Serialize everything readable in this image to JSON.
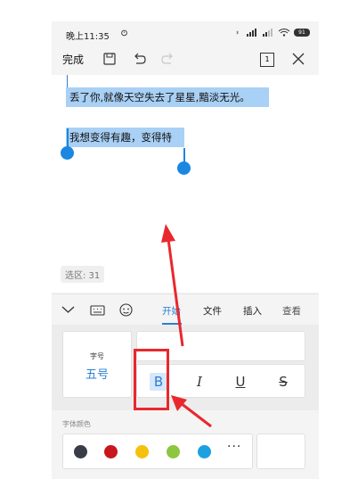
{
  "status_bar": {
    "time": "晚上11:35",
    "battery": "91"
  },
  "toolbar": {
    "done_label": "完成",
    "page_count": "1"
  },
  "document": {
    "line1": "丢了你,就像天空失去了星星,黯淡无光。",
    "line2": "我想变得有趣，变得特",
    "selection_badge": "选区: 31"
  },
  "tabs": [
    {
      "label": "开始",
      "active": true
    },
    {
      "label": "文件",
      "active": false
    },
    {
      "label": "插入",
      "active": false
    },
    {
      "label": "查看",
      "active": false
    }
  ],
  "format_panel": {
    "font_size_label": "字号",
    "font_size_value": "五号",
    "bold_glyph": "B",
    "italic_glyph": "I",
    "underline_glyph": "U",
    "strike_glyph": "S"
  },
  "color_panel": {
    "label": "字体颜色",
    "swatches": [
      "#3a3d48",
      "#c8161d",
      "#f5c10e",
      "#8dc63f",
      "#1ba1e2"
    ],
    "more_label": "···"
  },
  "colors": {
    "accent": "#2b7fd3",
    "selection": "#a9d0f5",
    "annotation": "#e8282e"
  }
}
